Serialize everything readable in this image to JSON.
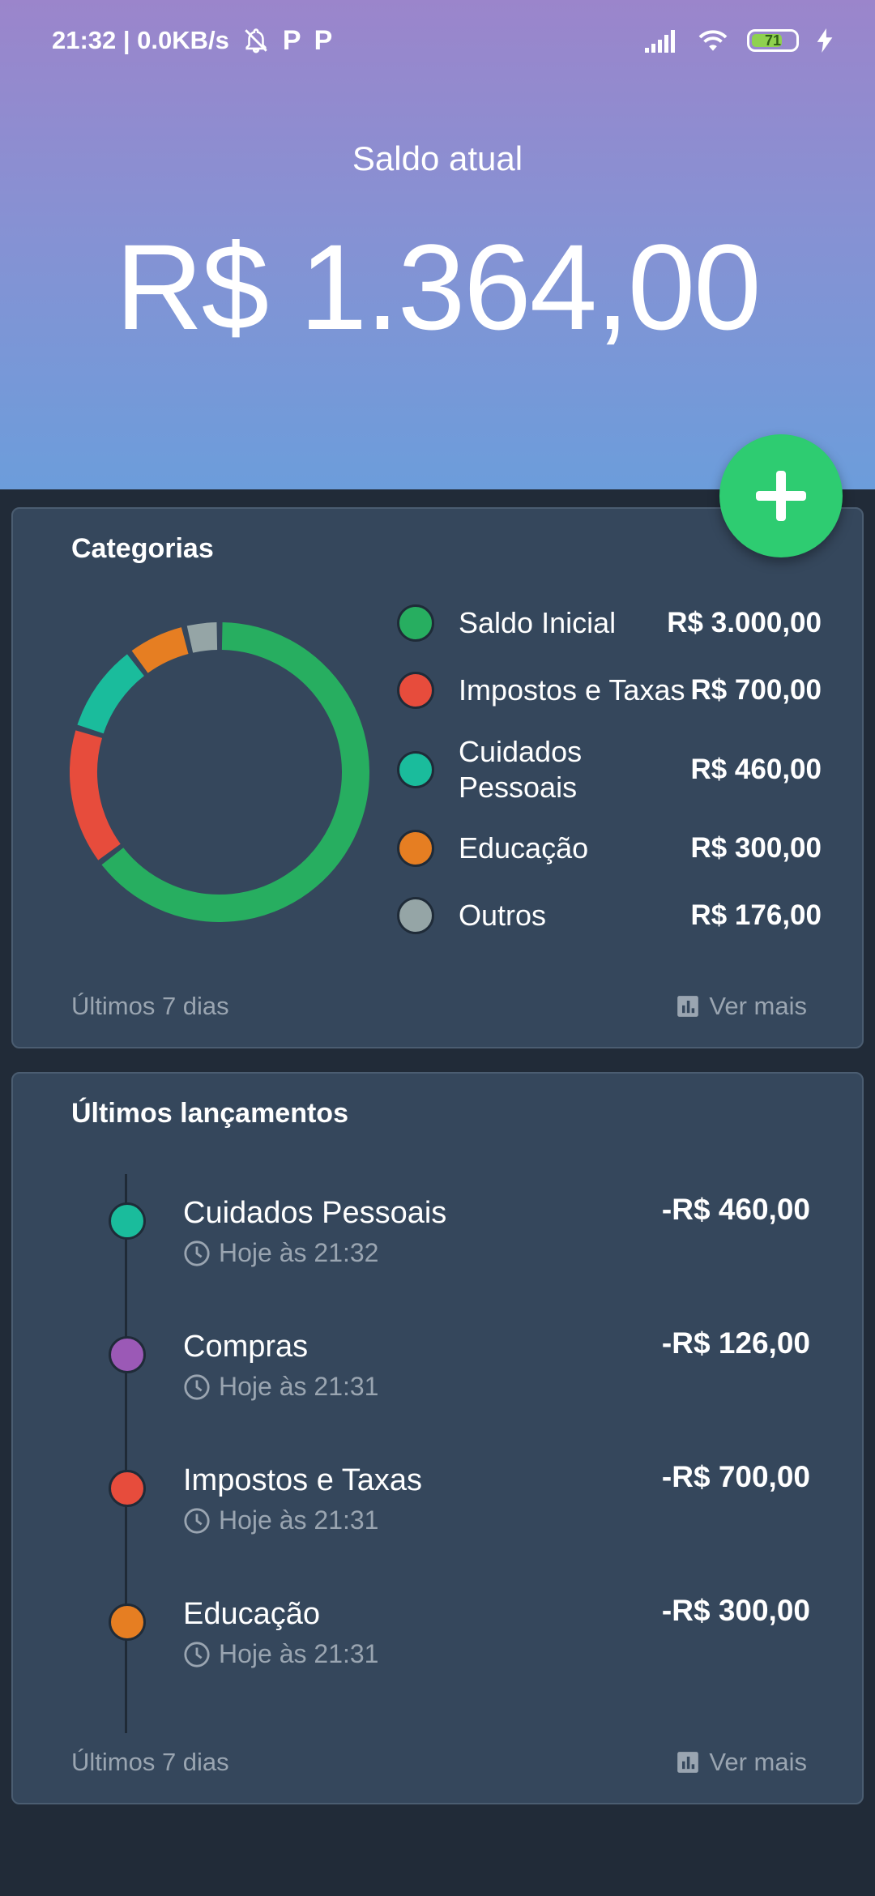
{
  "status_bar": {
    "time_speed": "21:32 | 0.0KB/s",
    "notif_icons": [
      "P",
      "P"
    ],
    "battery": "71",
    "battery_level": 0.71
  },
  "header": {
    "label": "Saldo atual",
    "balance": "R$ 1.364,00"
  },
  "fab": {
    "icon": "plus-icon",
    "color": "#2ecc71"
  },
  "categories": {
    "title": "Categorias",
    "items": [
      {
        "label": "Saldo Inicial",
        "value": "R$ 3.000,00",
        "amount": 3000,
        "color": "#27ae60"
      },
      {
        "label": "Impostos e Taxas",
        "value": "R$ 700,00",
        "amount": 700,
        "color": "#e74c3c"
      },
      {
        "label": "Cuidados Pessoais",
        "value": "R$ 460,00",
        "amount": 460,
        "color": "#1abc9c"
      },
      {
        "label": "Educação",
        "value": "R$ 300,00",
        "amount": 300,
        "color": "#e67e22"
      },
      {
        "label": "Outros",
        "value": "R$ 176,00",
        "amount": 176,
        "color": "#95a5a6"
      }
    ],
    "footer_left": "Últimos 7 dias",
    "footer_right": "Ver mais"
  },
  "transactions": {
    "title": "Últimos lançamentos",
    "items": [
      {
        "name": "Cuidados Pessoais",
        "time": "Hoje às 21:32",
        "amount": "-R$ 460,00",
        "color": "#1abc9c"
      },
      {
        "name": "Compras",
        "time": "Hoje às 21:31",
        "amount": "-R$ 126,00",
        "color": "#9b59b6"
      },
      {
        "name": "Impostos e Taxas",
        "time": "Hoje às 21:31",
        "amount": "-R$ 700,00",
        "color": "#e74c3c"
      },
      {
        "name": "Educação",
        "time": "Hoje às 21:31",
        "amount": "-R$ 300,00",
        "color": "#e67e22"
      }
    ],
    "footer_left": "Últimos 7 dias",
    "footer_right": "Ver mais"
  }
}
